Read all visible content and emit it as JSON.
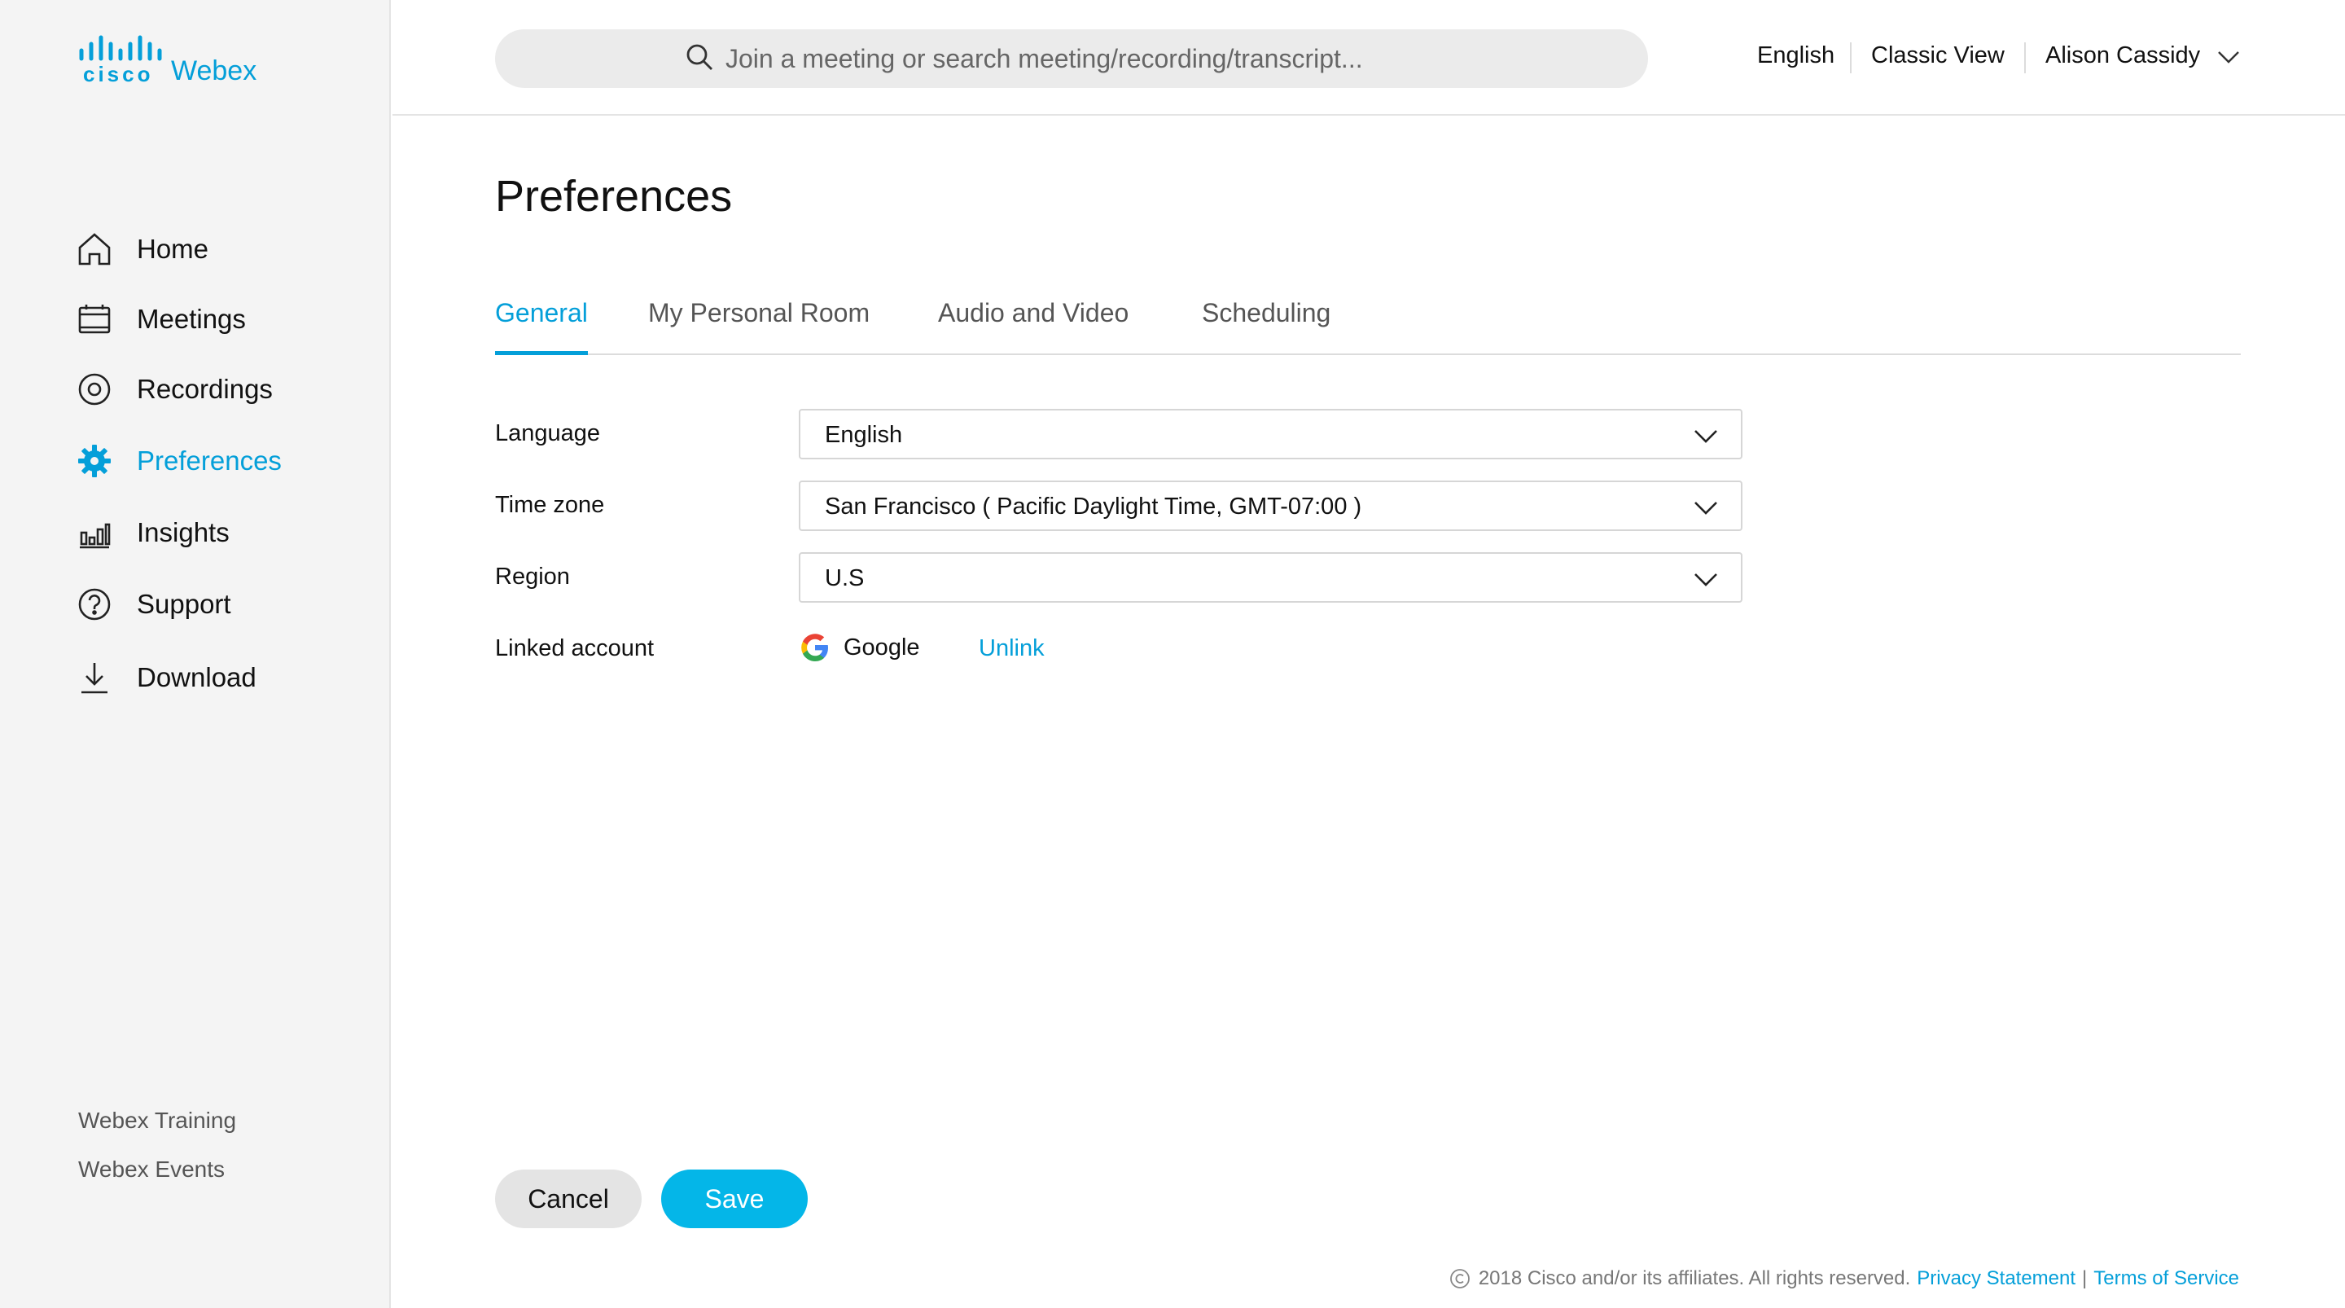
{
  "brand": {
    "cisco": "cisco",
    "product": "Webex",
    "color": "#049fd9"
  },
  "sidebar": {
    "items": [
      {
        "label": "Home",
        "icon": "home-icon",
        "active": false
      },
      {
        "label": "Meetings",
        "icon": "calendar-icon",
        "active": false
      },
      {
        "label": "Recordings",
        "icon": "recording-icon",
        "active": false
      },
      {
        "label": "Preferences",
        "icon": "gear-icon",
        "active": true
      },
      {
        "label": "Insights",
        "icon": "bar-chart-icon",
        "active": false
      },
      {
        "label": "Support",
        "icon": "help-icon",
        "active": false
      },
      {
        "label": "Download",
        "icon": "download-icon",
        "active": false
      }
    ],
    "links": [
      "Webex Training",
      "Webex Events"
    ]
  },
  "header": {
    "search_placeholder": "Join a meeting or search meeting/recording/transcript...",
    "language": "English",
    "classic_view": "Classic View",
    "user_name": "Alison Cassidy"
  },
  "page": {
    "title": "Preferences",
    "tabs": [
      "General",
      "My Personal Room",
      "Audio and Video",
      "Scheduling"
    ],
    "active_tab": "General"
  },
  "form": {
    "language": {
      "label": "Language",
      "value": "English"
    },
    "timezone": {
      "label": "Time zone",
      "value": "San Francisco ( Pacific Daylight Time, GMT-07:00 )"
    },
    "region": {
      "label": "Region",
      "value": "U.S"
    },
    "linked_account": {
      "label": "Linked account",
      "provider": "Google",
      "action": "Unlink"
    }
  },
  "buttons": {
    "cancel": "Cancel",
    "save": "Save"
  },
  "footer": {
    "copyright": "2018 Cisco and/or its affiliates. All rights reserved.",
    "privacy": "Privacy Statement",
    "separator": "|",
    "terms": "Terms of Service"
  },
  "colors": {
    "accent": "#049fd9",
    "save_button": "#04b6e8",
    "sidebar_bg": "#f4f4f4"
  }
}
